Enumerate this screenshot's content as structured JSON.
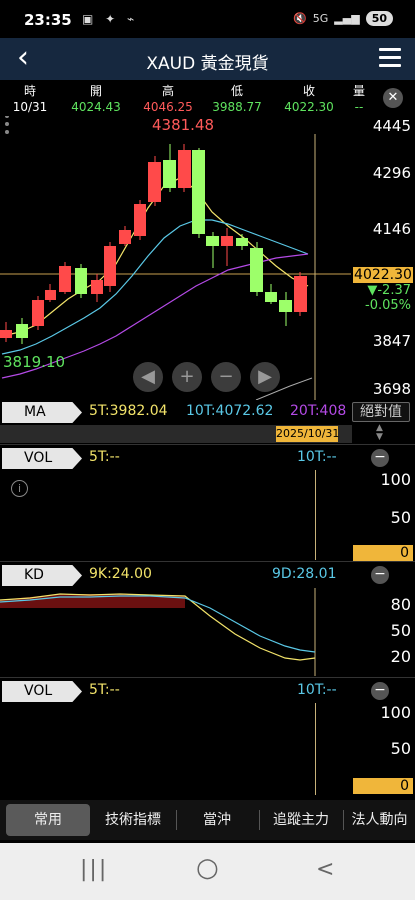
{
  "status": {
    "time": "23:35",
    "icons": "▣ ✦ ⌁",
    "signal": "5G",
    "battery": "50"
  },
  "header": {
    "title": "XAUD 黃金現貨",
    "back_icon": "chevron-left-icon",
    "menu_icon": "hamburger-menu-icon"
  },
  "quote": {
    "labels": [
      "時",
      "開",
      "高",
      "低",
      "收",
      "量"
    ],
    "values": [
      "10/31",
      "4024.43",
      "4046.25",
      "3988.77",
      "4022.30",
      "--"
    ],
    "colors": [
      "#ffffff",
      "#5fe35f",
      "#ff5a5a",
      "#5fe35f",
      "#5fe35f",
      "#5fe35f"
    ]
  },
  "price_axis": {
    "ticks": [
      "4445",
      "4296",
      "4146",
      "3847",
      "3698"
    ],
    "current": "4022.30",
    "change": "▼-2.37",
    "change_pct": "-0.05%"
  },
  "main_chart": {
    "high_label": "4381.48",
    "low_label": "3819.10",
    "up_color": "#ff4a4a",
    "down_color": "#9dff6a"
  },
  "nav_buttons": [
    "◀",
    "+",
    "−",
    "▶"
  ],
  "ma": {
    "tag": "MA",
    "ma5": "5T:3982.04",
    "ma10": "10T:4072.62",
    "ma20": "20T:408",
    "abs_button": "絕對值"
  },
  "date_cursor": "2025/10/31",
  "vol1": {
    "tag": "VOL",
    "t5": "5T:--",
    "t10": "10T:--",
    "ticks": [
      "100",
      "50",
      "0"
    ]
  },
  "kd": {
    "tag": "KD",
    "k": "9K:24.00",
    "d": "9D:28.01",
    "ticks": [
      "80",
      "50",
      "20"
    ]
  },
  "vol2": {
    "tag": "VOL",
    "t5": "5T:--",
    "t10": "10T:--",
    "ticks": [
      "100",
      "50",
      "0"
    ]
  },
  "tabs": [
    "常用",
    "技術指標",
    "當沖",
    "追蹤主力",
    "法人動向"
  ],
  "android_nav": [
    "|||",
    "○",
    "<"
  ]
}
